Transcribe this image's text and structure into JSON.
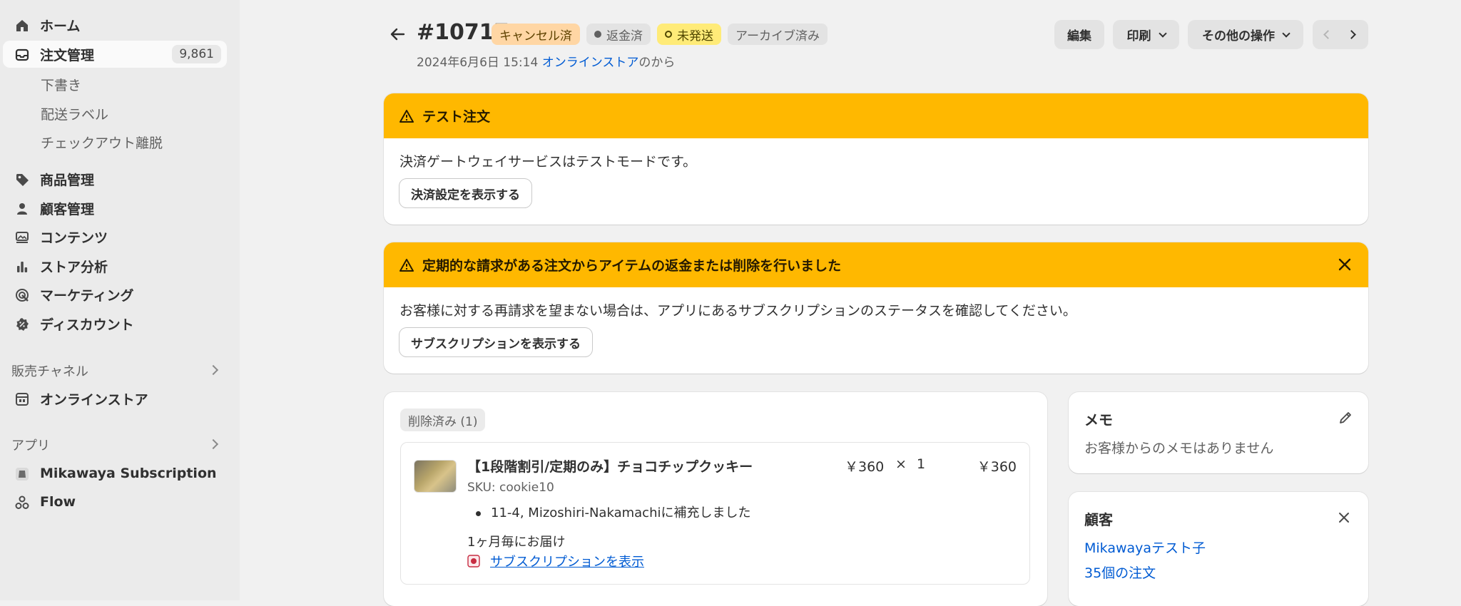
{
  "sidebar": {
    "items": [
      {
        "label": "ホーム",
        "icon": "home-icon"
      },
      {
        "label": "注文管理",
        "icon": "inbox-icon",
        "count": "9,861"
      },
      {
        "label": "商品管理",
        "icon": "tag-icon"
      },
      {
        "label": "顧客管理",
        "icon": "person-icon"
      },
      {
        "label": "コンテンツ",
        "icon": "content-icon"
      },
      {
        "label": "ストア分析",
        "icon": "chart-icon"
      },
      {
        "label": "マーケティング",
        "icon": "target-icon"
      },
      {
        "label": "ディスカウント",
        "icon": "discount-icon"
      }
    ],
    "order_subitems": [
      "下書き",
      "配送ラベル",
      "チェックアウト離脱"
    ],
    "sales_channels_label": "販売チャネル",
    "online_store": "オンラインストア",
    "apps_label": "アプリ",
    "apps": [
      "Mikawaya Subscription",
      "Flow"
    ]
  },
  "header": {
    "order_number": "#10717",
    "badges": [
      {
        "label": "キャンセル済",
        "bg": "#ffd6a4",
        "color": "#5e4200"
      },
      {
        "label": "返金済",
        "bg": "#e3e3e3",
        "color": "#616161"
      },
      {
        "label": "未発送",
        "bg": "#ffeb78",
        "color": "#4f4700"
      },
      {
        "label": "アーカイブ済み",
        "bg": "#e3e3e3",
        "color": "#616161"
      }
    ],
    "date": "2024年6月6日 15:14",
    "source_link": "オンラインストア",
    "source_suffix": "のから",
    "edit_label": "編集",
    "print_label": "印刷",
    "more_label": "その他の操作"
  },
  "test_banner": {
    "title": "テスト注文",
    "message": "決済ゲートウェイサービスはテストモードです。",
    "button": "決済設定を表示する"
  },
  "subscription_banner": {
    "title": "定期的な請求がある注文からアイテムの返金または削除を行いました",
    "message": "お客様に対する再請求を望まない場合は、アプリにあるサブスクリプションのステータスを確認してください。",
    "button": "サブスクリプションを表示する"
  },
  "removed_items": {
    "pill": "削除済み (1)",
    "item": {
      "name": "【1段階割引/定期のみ】チョコチップクッキー",
      "sku": "SKU: cookie10",
      "restock_note": "11-4, Mizoshiri-Nakamachiに補充しました",
      "price": "￥360",
      "times": "×",
      "qty": "1",
      "total": "￥360",
      "delivery": "1ヶ月毎にお届け",
      "subscription_link": "サブスクリプションを表示"
    }
  },
  "memo": {
    "title": "メモ",
    "text": "お客様からのメモはありません"
  },
  "customer": {
    "title": "顧客",
    "name": "Mikawayaテスト子",
    "orders": "35個の注文"
  }
}
